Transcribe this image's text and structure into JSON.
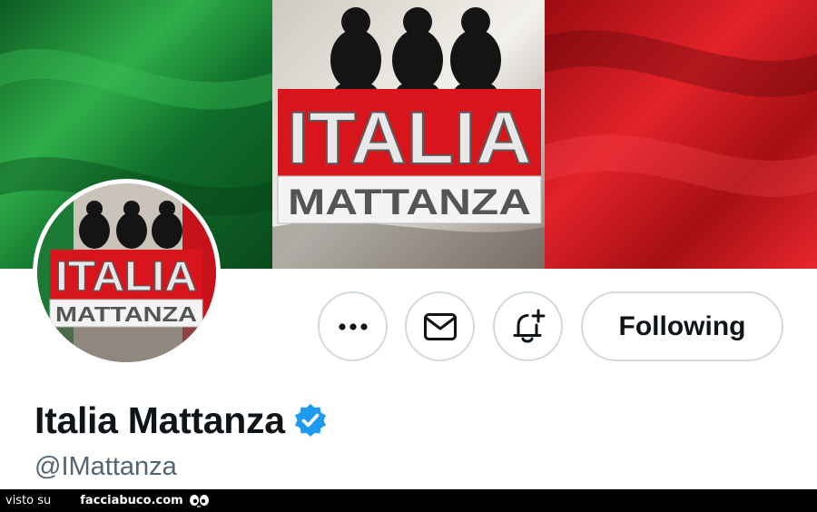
{
  "banner": {
    "sign_top": "ITALIA",
    "sign_bottom": "MATTANZA",
    "flag_colors": {
      "green": "#1f8a3a",
      "white": "#e9e6e0",
      "red": "#d9161e"
    }
  },
  "avatar": {
    "sign_top": "ITALIA",
    "sign_bottom": "MATTANZA"
  },
  "actions": {
    "more_icon": "more-icon",
    "message_icon": "envelope-icon",
    "notify_icon": "bell-plus-icon",
    "follow_label": "Following"
  },
  "profile": {
    "display_name": "Italia Mattanza",
    "handle": "@IMattanza",
    "verified_color": "#1d9bf0"
  },
  "footer": {
    "prefix": "visto su",
    "brand": "facciabuco.com"
  }
}
